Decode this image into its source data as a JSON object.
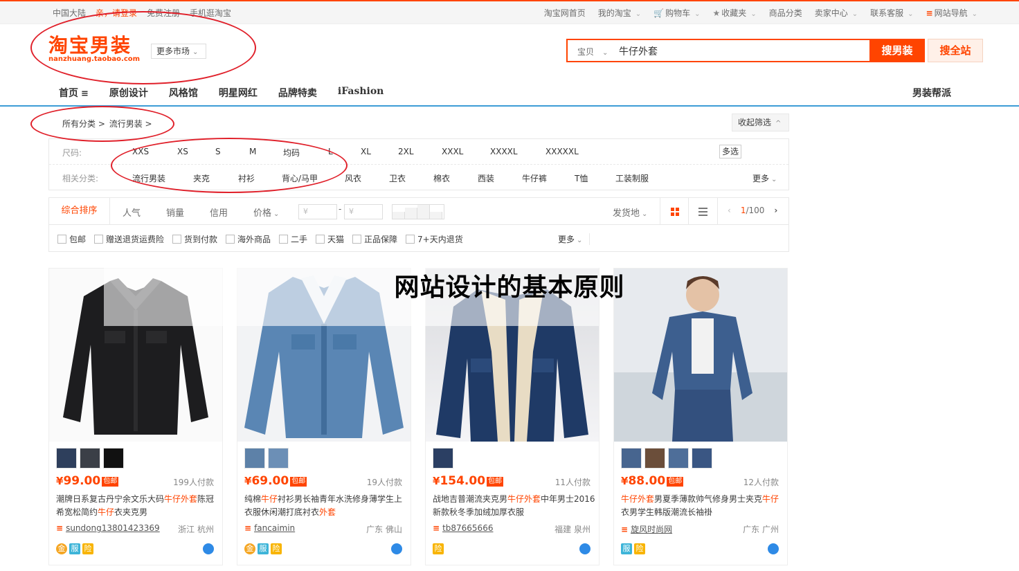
{
  "topbar": {
    "region": "中国大陆",
    "login": "亲，请登录",
    "register": "免费注册",
    "mobile": "手机逛淘宝",
    "right": [
      "淘宝网首页",
      "我的淘宝",
      "购物车",
      "收藏夹",
      "商品分类",
      "卖家中心",
      "联系客服",
      "网站导航"
    ]
  },
  "header": {
    "logo_cn": "淘宝男装",
    "logo_en": "nanzhuang.taobao.com",
    "more_market": "更多市场",
    "search_category": "宝贝",
    "search_value": "牛仔外套",
    "search_men": "搜男装",
    "search_all": "搜全站"
  },
  "nav": {
    "items": [
      "首页",
      "原创设计",
      "风格馆",
      "明星网红",
      "品牌特卖",
      "iFashion"
    ],
    "right": "男装帮派"
  },
  "breadcrumb": [
    "所有分类 >",
    "流行男装 >"
  ],
  "collapse": "收起筛选",
  "filters": {
    "size_label": "尺码:",
    "sizes": [
      "XXS",
      "XS",
      "S",
      "M",
      "均码",
      "L",
      "XL",
      "2XL",
      "XXXL",
      "XXXXL",
      "XXXXXL"
    ],
    "multi": "多选",
    "cat_label": "相关分类:",
    "cats": [
      "流行男装",
      "夹克",
      "衬衫",
      "背心/马甲",
      "风衣",
      "卫衣",
      "棉衣",
      "西装",
      "牛仔裤",
      "T恤",
      "工装制服"
    ],
    "more": "更多"
  },
  "sort": {
    "active": "综合排序",
    "items": [
      "人气",
      "销量",
      "信用"
    ],
    "price": "价格",
    "yen": "¥",
    "dash": "-",
    "ship_from": "发货地",
    "page_current": "1",
    "page_total": "/100"
  },
  "checks": [
    "包邮",
    "赠送退货运费险",
    "货到付款",
    "海外商品",
    "二手",
    "天猫",
    "正品保障",
    "7+天内退货"
  ],
  "checks_more": "更多",
  "overlay_title": "网站设计的基本原则",
  "products": [
    {
      "price": "99.00",
      "baoyou": "包邮",
      "sold": "199人付款",
      "title": "潮牌日系复古丹宁余文乐大码牛仔外套陈冠希宽松简约牛仔衣夹克男",
      "shop": "sundong13801423369",
      "location": "浙江 杭州",
      "badges": [
        "金",
        "服",
        "险"
      ]
    },
    {
      "price": "69.00",
      "baoyou": "包邮",
      "sold": "19人付款",
      "title": "纯棉牛仔衬衫男长袖青年水洗修身薄学生上衣服休闲潮打底衬衣外套",
      "shop": "fancaimin",
      "location": "广东 佛山",
      "badges": [
        "金",
        "服",
        "险"
      ]
    },
    {
      "price": "154.00",
      "baoyou": "包邮",
      "sold": "11人付款",
      "title": "战地吉普潮流夹克男牛仔外套中年男士2016新款秋冬季加绒加厚衣服",
      "shop": "tb87665666",
      "location": "福建 泉州",
      "badges": [
        "险"
      ]
    },
    {
      "price": "88.00",
      "baoyou": "包邮",
      "sold": "12人付款",
      "title": "牛仔外套男夏季薄款帅气修身男士夹克牛仔衣男学生韩版潮流长袖褂",
      "shop": "旋风时尚网",
      "location": "广东 广州",
      "badges": [
        "服",
        "险"
      ]
    }
  ],
  "colors": {
    "accent": "#ff4400",
    "nav_line": "#3d9cd6",
    "annotation": "#e0202a"
  }
}
